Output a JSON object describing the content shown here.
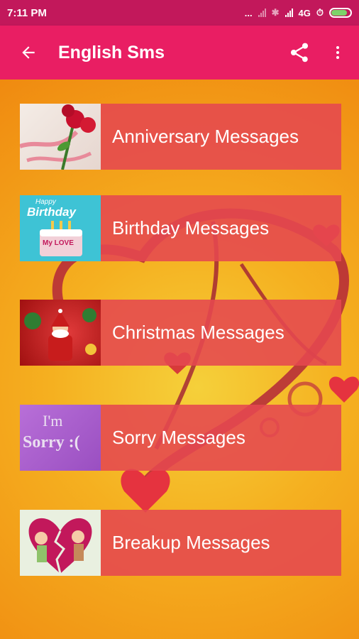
{
  "status_bar": {
    "time": "7:11 PM",
    "dots": "...",
    "network": "4G",
    "battery_level": 0.8
  },
  "app_bar": {
    "title": "English Sms"
  },
  "items": [
    {
      "label": "Anniversary Messages"
    },
    {
      "label": "Birthday Messages",
      "thumb_text_top": "Happy",
      "thumb_text": "Birthday",
      "thumb_cake_text": "My LOVE"
    },
    {
      "label": "Christmas Messages"
    },
    {
      "label": "Sorry Messages",
      "thumb_text_1": "I'm",
      "thumb_text_2": "Sorry :("
    },
    {
      "label": "Breakup Messages"
    }
  ],
  "colors": {
    "status_bar": "#c2185b",
    "app_bar": "#e91e63",
    "item_bg": "#e54850"
  }
}
